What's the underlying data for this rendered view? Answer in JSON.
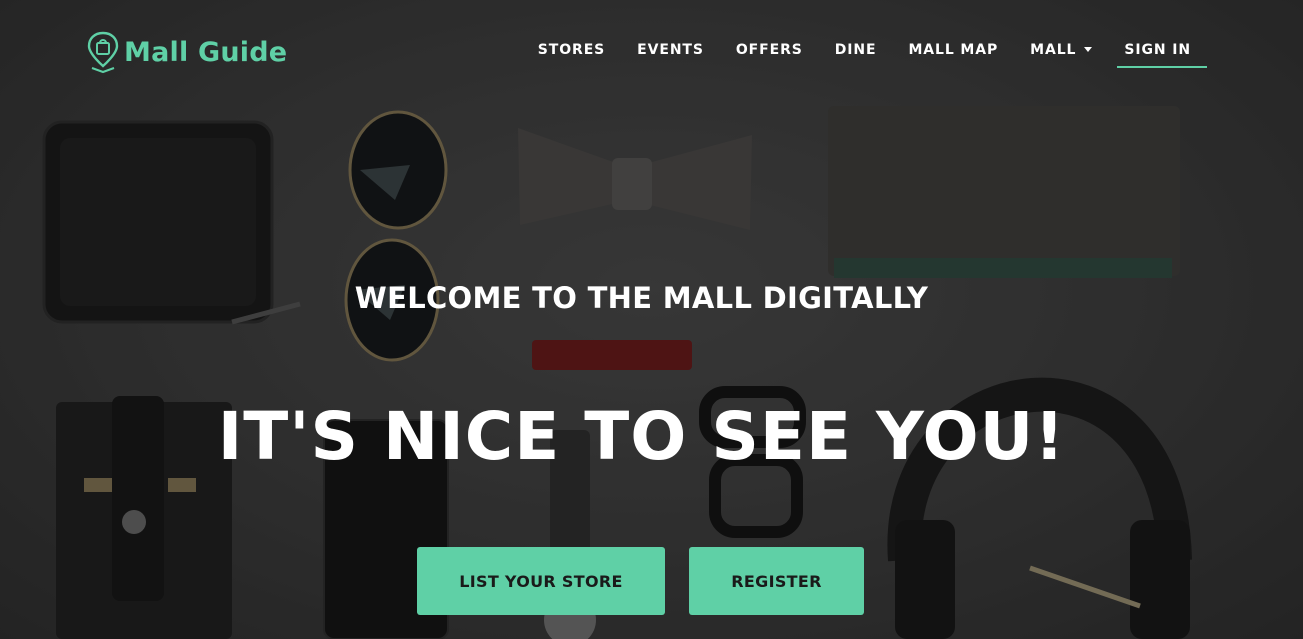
{
  "brand": {
    "name": "Mall Guide",
    "icon": "location-pin-shopping-bag-icon"
  },
  "nav": {
    "items": [
      {
        "label": "STORES"
      },
      {
        "label": "EVENTS"
      },
      {
        "label": "OFFERS"
      },
      {
        "label": "DINE"
      },
      {
        "label": "MALL MAP"
      },
      {
        "label": "MALL",
        "dropdown": true
      },
      {
        "label": "SIGN IN",
        "active": true
      }
    ]
  },
  "hero": {
    "subheading": "WELCOME TO THE MALL DIGITALLY",
    "heading": "IT'S NICE TO SEE YOU!",
    "buttons": {
      "list_store": "LIST YOUR STORE",
      "register": "REGISTER"
    }
  },
  "colors": {
    "accent": "#5fd0a6",
    "text": "#ffffff",
    "button_text": "#1a1a1a"
  }
}
